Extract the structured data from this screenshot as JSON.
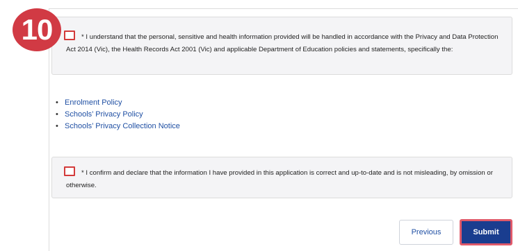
{
  "step_number": "10",
  "declarations": [
    {
      "text": "* I understand that the personal, sensitive and health information provided will be handled in accordance with the Privacy and Data Protection Act 2014 (Vic), the Health Records Act 2001 (Vic) and applicable Department of Education policies and statements, specifically the:"
    },
    {
      "text": "* I confirm and declare that the information I have provided in this application is correct and up-to-date and is not misleading, by omission or otherwise."
    }
  ],
  "policy_links": [
    "Enrolment Policy",
    "Schools’ Privacy Policy",
    "Schools’ Privacy Collection Notice"
  ],
  "buttons": {
    "previous": "Previous",
    "submit": "Submit"
  },
  "colors": {
    "accent_red": "#d13a44",
    "link_blue": "#1f4fa3",
    "submit_bg": "#1a3d8f"
  }
}
